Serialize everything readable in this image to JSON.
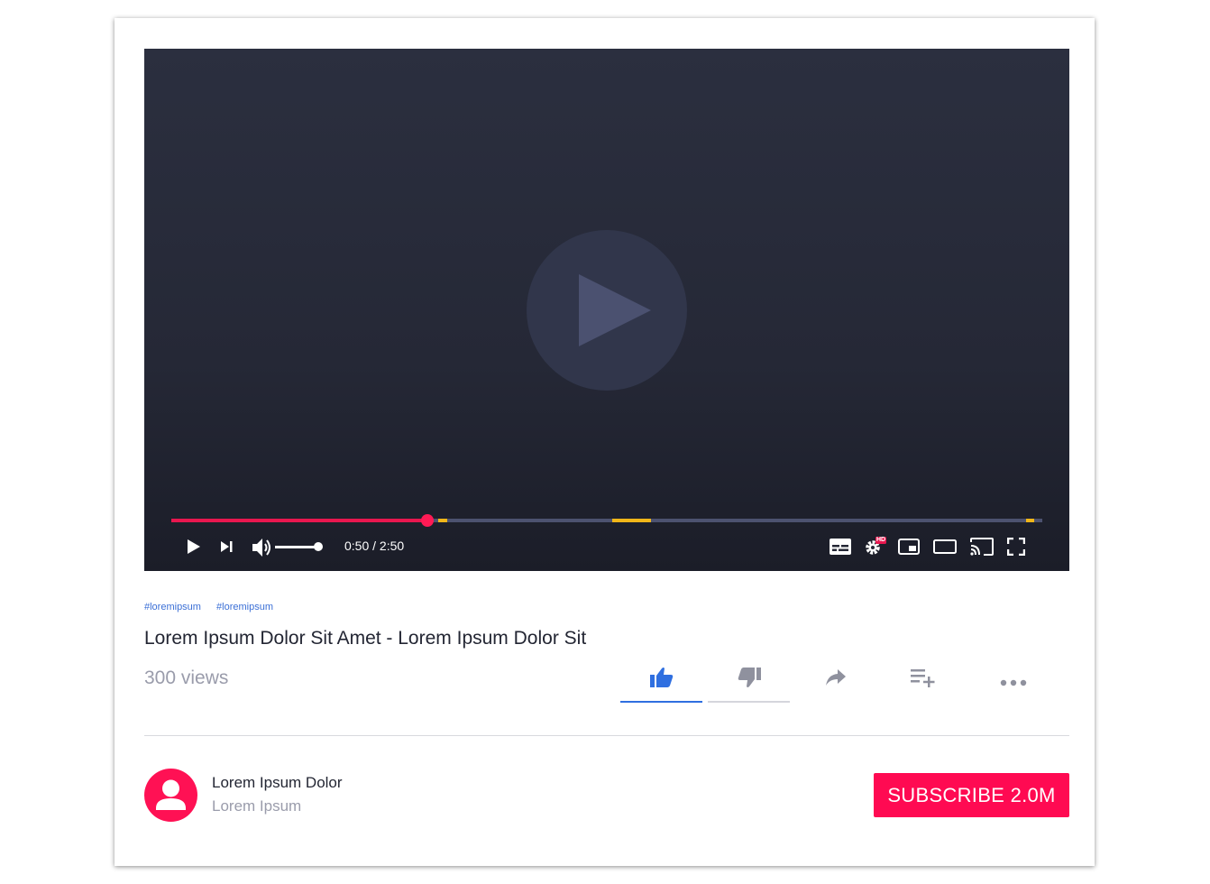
{
  "player": {
    "current_time": "0:50",
    "duration": "2:50",
    "time_display": "0:50 / 2:50",
    "progress_played_fraction": 0.294,
    "chapter_markers": [
      {
        "start": 0.306,
        "end": 0.316
      },
      {
        "start": 0.506,
        "end": 0.55
      },
      {
        "start": 0.981,
        "end": 0.99
      }
    ],
    "volume_fraction": 0.92,
    "quality_badge": "HD",
    "colors": {
      "background": "#252836",
      "progress_played": "#e8174f",
      "progress_unplayed": "#4c5270",
      "chapter_marker": "#f0b619"
    }
  },
  "video": {
    "hashtags": [
      "#loremipsum",
      "#loremipsum"
    ],
    "title": "Lorem Ipsum Dolor Sit Amet - Lorem Ipsum Dolor Sit",
    "views": "300 views"
  },
  "actions": {
    "items": [
      {
        "icon": "thumbs-up-icon",
        "active": true
      },
      {
        "icon": "thumbs-down-icon",
        "active": false
      },
      {
        "icon": "share-icon",
        "active": false
      },
      {
        "icon": "add-to-playlist-icon",
        "active": false
      },
      {
        "icon": "more-icon",
        "active": false
      }
    ],
    "colors": {
      "active": "#2f6fe0",
      "inactive": "#8f919e",
      "like_bar": "#2f6fe0",
      "dislike_bar": "#d5d6dc"
    }
  },
  "channel": {
    "name": "Lorem Ipsum Dolor",
    "subtitle": "Lorem Ipsum",
    "subscribe_label": "SUBSCRIBE 2.0M",
    "brand_color": "#ff0a52"
  }
}
